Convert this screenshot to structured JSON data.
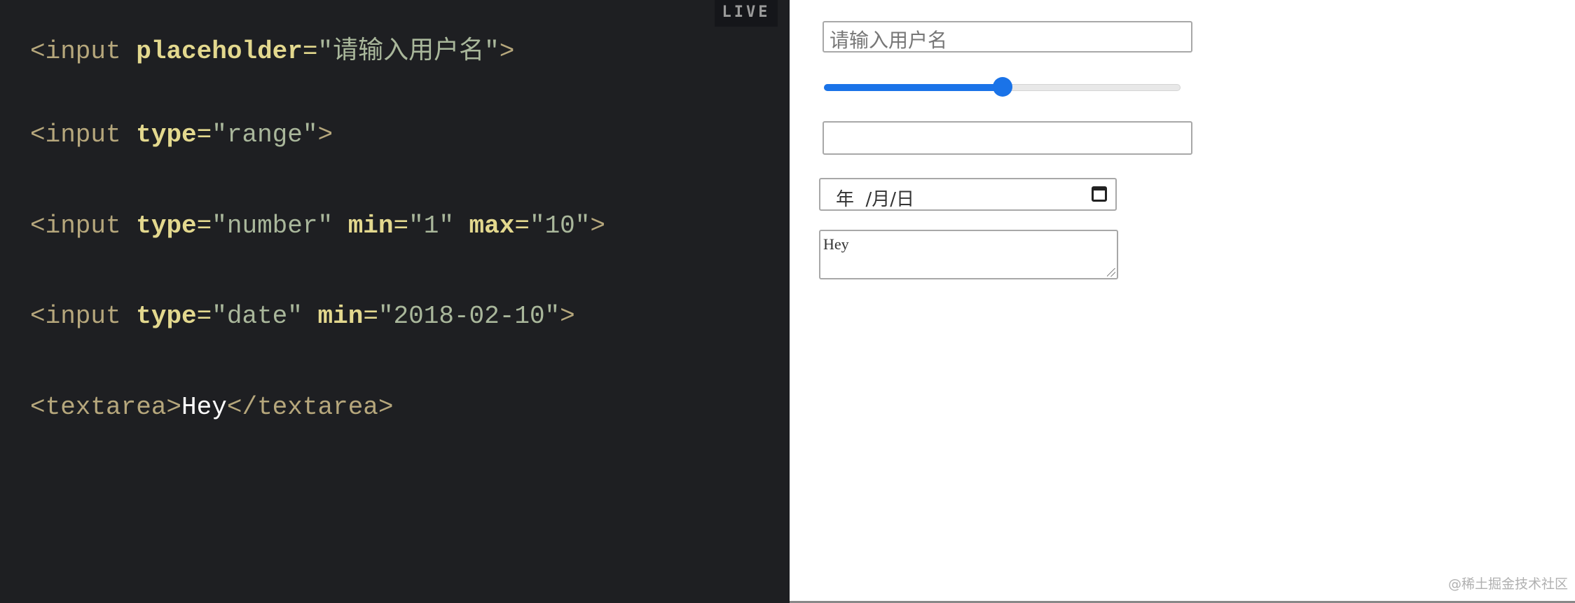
{
  "editor": {
    "live_badge": "LIVE",
    "lines": [
      {
        "tag_open": "<input ",
        "attr1": "placeholder",
        "eq1": "=",
        "val1": "\"请输入用户名\"",
        "tag_close": ">"
      },
      {
        "tag_open": "<input ",
        "attr1": "type",
        "eq1": "=",
        "val1": "\"range\"",
        "tag_close": ">"
      },
      {
        "tag_open": "<input ",
        "attr1": "type",
        "eq1": "=",
        "val1": "\"number\" ",
        "attr2": "min",
        "eq2": "=",
        "val2": "\"1\" ",
        "attr3": "max",
        "eq3": "=",
        "val3": "\"10\"",
        "tag_close": ">"
      },
      {
        "tag_open": "<input ",
        "attr1": "type",
        "eq1": "=",
        "val1": "\"date\" ",
        "attr2": "min",
        "eq2": "=",
        "val2": "\"2018-02-10\"",
        "tag_close": ">"
      },
      {
        "tag_open": "<textarea>",
        "text": "Hey",
        "tag_close": "</textarea>"
      }
    ]
  },
  "preview": {
    "text_input_placeholder": "请输入用户名",
    "range_value_fraction": 0.5,
    "number_value": "",
    "date_placeholder": "年  /月/日",
    "textarea_value": "Hey",
    "accent_color": "#1a73e8"
  },
  "watermark": "@稀土掘金技术社区"
}
